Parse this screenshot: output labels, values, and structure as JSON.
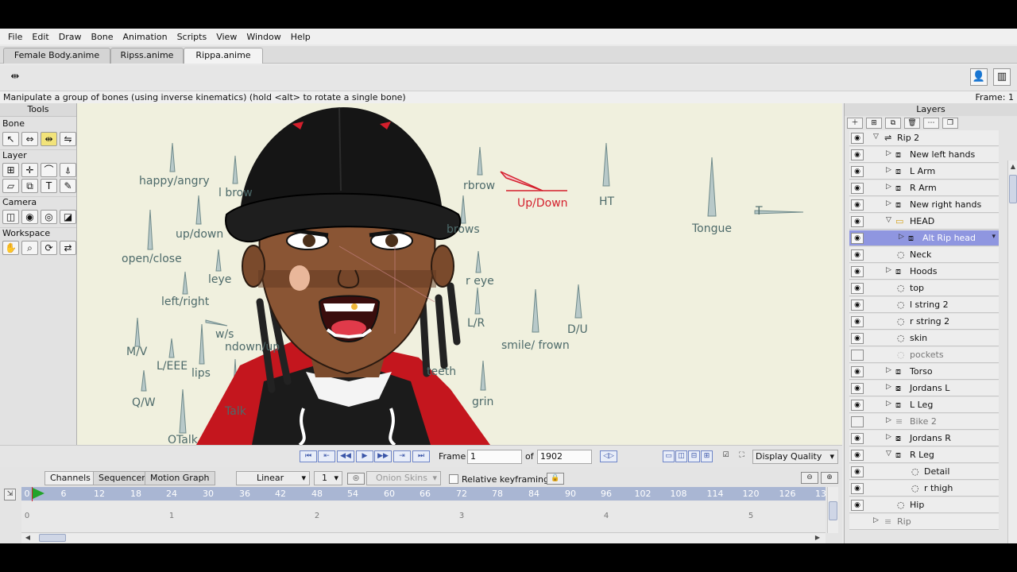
{
  "menu": [
    "File",
    "Edit",
    "Draw",
    "Bone",
    "Animation",
    "Scripts",
    "View",
    "Window",
    "Help"
  ],
  "doc_tabs": [
    "Female Body.anime",
    "Ripss.anime",
    "Rippa.anime"
  ],
  "status": {
    "message": "Manipulate a group of bones (using inverse kinematics) (hold <alt> to rotate a single bone)",
    "frame": "Frame: 1"
  },
  "tools": {
    "title": "Tools",
    "groups": [
      "Bone",
      "Layer",
      "Camera",
      "Workspace"
    ]
  },
  "bone_labels": [
    "happy/angry",
    "l brow",
    "rbrow",
    "Up/Down",
    "HT",
    "Tongue",
    "T",
    "brows",
    "up/down",
    "open/close",
    "leye",
    "r eye",
    "left/right",
    "L/R",
    "D/U",
    "smile/ frown",
    "w/s",
    "ndown/up",
    "M/V",
    "L/EEE",
    "lips",
    "teeth",
    "Q/W",
    "Talk",
    "grin",
    "OTalk"
  ],
  "playback": {
    "frame_label": "Frame",
    "frame_value": "1",
    "of_label": "of",
    "total": "1902",
    "display_quality": "Display Quality"
  },
  "timeline": {
    "tabs": [
      "Channels",
      "Sequencer",
      "Motion Graph"
    ],
    "interp": "Linear",
    "step": "1",
    "onion": "Onion Skins",
    "relative": "Relative keyframing",
    "ruler_ticks": [
      "0",
      "6",
      "12",
      "18",
      "24",
      "30",
      "36",
      "42",
      "48",
      "54",
      "60",
      "66",
      "72",
      "78",
      "84",
      "90",
      "96",
      "102",
      "108",
      "114",
      "120",
      "126",
      "13"
    ],
    "second_ticks": [
      "0",
      "1",
      "2",
      "3",
      "4",
      "5"
    ]
  },
  "layers": {
    "title": "Layers",
    "items": [
      {
        "name": "Rip 2"
      },
      {
        "name": "New left hands"
      },
      {
        "name": "L Arm"
      },
      {
        "name": "R Arm"
      },
      {
        "name": "New right hands"
      },
      {
        "name": "HEAD"
      },
      {
        "name": "Alt Rip head"
      },
      {
        "name": "Neck"
      },
      {
        "name": "Hoods"
      },
      {
        "name": "top"
      },
      {
        "name": "l string  2"
      },
      {
        "name": "r string 2"
      },
      {
        "name": "skin"
      },
      {
        "name": "pockets"
      },
      {
        "name": "Torso"
      },
      {
        "name": "Jordans L"
      },
      {
        "name": "L Leg"
      },
      {
        "name": "Bike 2"
      },
      {
        "name": "Jordans R"
      },
      {
        "name": "R Leg"
      },
      {
        "name": "Detail"
      },
      {
        "name": "r thigh"
      },
      {
        "name": "Hip"
      },
      {
        "name": "Rip"
      }
    ]
  },
  "colors": {
    "accent": "#8f96e0",
    "bone_label": "#4d6a6a",
    "selected_bone": "#d41f2c",
    "canvas": "#f0f0de",
    "ruler": "#a9b6d3"
  }
}
